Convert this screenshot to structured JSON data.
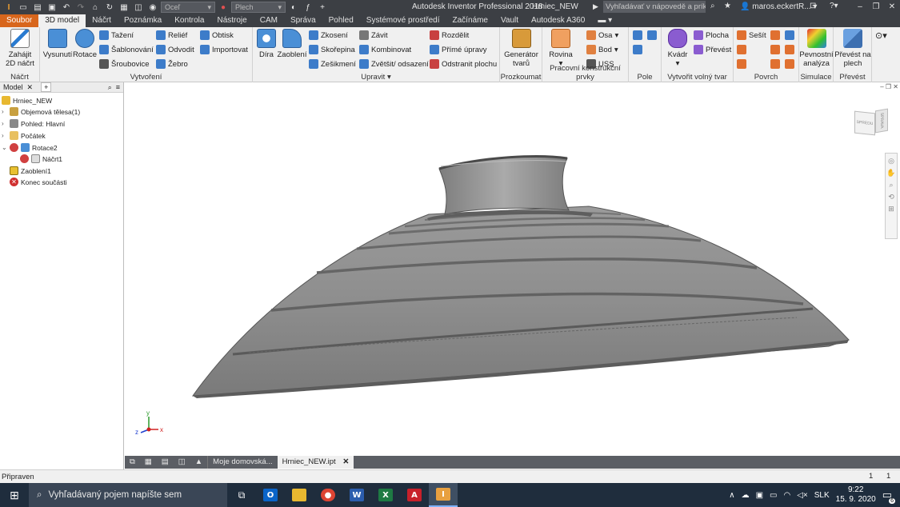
{
  "title_bar": {
    "app_title": "Autodesk Inventor Professional 2018",
    "document": "Hrniec_NEW",
    "material_dropdown": "Oceľ",
    "style_dropdown": "Plech",
    "search_placeholder": "Vyhľadávať v nápovedě a príkaz",
    "user": "maros.eckertR..."
  },
  "tabs": [
    "Soubor",
    "3D model",
    "Náčrt",
    "Poznámka",
    "Kontrola",
    "Nástroje",
    "CAM",
    "Správa",
    "Pohled",
    "Systémové prostředí",
    "Začínáme",
    "Vault",
    "Autodesk A360"
  ],
  "ribbon": {
    "nacrt": {
      "title": "Náčrt",
      "start_sketch_line1": "Zahájit",
      "start_sketch_line2": "2D náčrt"
    },
    "vytvoreni": {
      "title": "Vytvoření",
      "vysunuti": "Vysunutí",
      "rotace": "Rotace",
      "tazeni": "Tažení",
      "sablonovani": "Šablonování",
      "sroubovice": "Šroubovice",
      "relief": "Reliéf",
      "odvodit": "Odvodit",
      "zebro": "Žebro",
      "obtisk": "Obtisk",
      "importovat": "Importovat"
    },
    "upravit": {
      "title": "Upravit",
      "dira": "Díra",
      "zaobleni": "Zaoblení",
      "zkoseni": "Zkosení",
      "skorepina": "Skořepina",
      "zesikmeni": "Zešikmení",
      "zavit": "Závit",
      "kombinovat": "Kombinovat",
      "zvetsit": "Zvětšit/ odsazení",
      "rozdelit": "Rozdělit",
      "prime_upravy": "Přímé úpravy",
      "odstranit_plochu": "Odstranit plochu"
    },
    "prozkoumat": {
      "title": "Prozkoumat",
      "generator_line1": "Generátor",
      "generator_line2": "tvarů"
    },
    "pracovni": {
      "title": "Pracovní konstrukční prvky",
      "rovina": "Rovina",
      "osa": "Osa",
      "bod": "Bod",
      "uss": "USS"
    },
    "pole": {
      "title": "Pole"
    },
    "volny_tvar": {
      "title": "Vytvořit volný tvar",
      "kvadr": "Kvádr",
      "plocha": "Plocha",
      "prevest": "Převést"
    },
    "povrch": {
      "title": "Povrch",
      "sesit": "Sešít"
    },
    "simulace": {
      "title": "Simulace",
      "pevnost_line1": "Pevnostní",
      "pevnost_line2": "analýza"
    },
    "prevest": {
      "title": "Převést",
      "plech_line1": "Převést na",
      "plech_line2": "plech"
    }
  },
  "browser": {
    "tab": "Model",
    "items": [
      {
        "label": "Hrniec_NEW"
      },
      {
        "label": "Objemová tělesa(1)"
      },
      {
        "label": "Pohled: Hlavní"
      },
      {
        "label": "Počátek"
      },
      {
        "label": "Rotace2"
      },
      {
        "label": "Náčrt1"
      },
      {
        "label": "Zaoblení1"
      },
      {
        "label": "Konec součásti"
      }
    ]
  },
  "viewcube": {
    "face_front": "SPREDU",
    "face_right": "SPRAVA"
  },
  "doc_tabs": {
    "home": "Moje domovská...",
    "active": "Hrniec_NEW.ipt"
  },
  "status": {
    "text": "Připraven",
    "num1": "1",
    "num2": "1"
  },
  "taskbar": {
    "search_placeholder": "Vyhľadávaný pojem napíšte sem",
    "language": "SLK",
    "time": "9:22",
    "date": "15. 9. 2020",
    "notifications": "6"
  },
  "colors": {
    "file_tab": "#d8661c",
    "titlebar": "#3c3f44",
    "model_surface": "#8c8c8c",
    "taskbar": "#1f2d3d"
  }
}
